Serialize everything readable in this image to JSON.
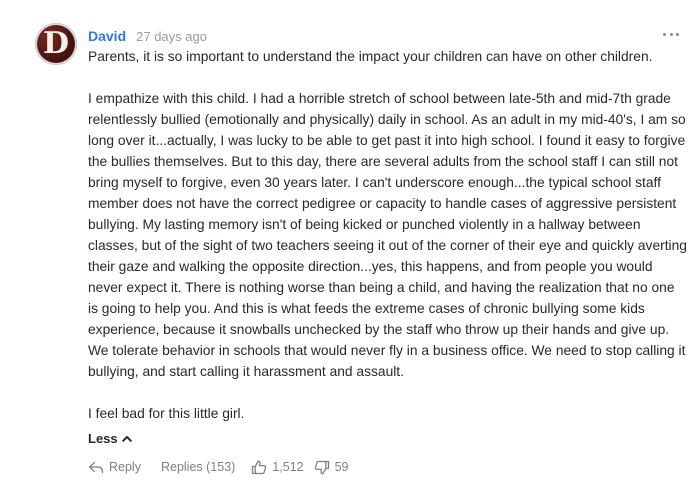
{
  "comment": {
    "avatar_letter": "D",
    "author": "David",
    "time": "27 days ago",
    "paragraphs": [
      "Parents, it is so important to understand the impact your children can have on other children.",
      "I empathize with this child. I had a horrible stretch of school between late-5th and mid-7th grade relentlessly bullied (emotionally and physically) daily in school. As an adult in my mid-40's, I am so long over it...actually, I was lucky to be able to get past it into high school. I found it easy to forgive the bullies themselves. But to this day, there are several adults from the school staff I can still not bring myself to forgive, even 30 years later. I can't underscore enough...the typical school staff member does not have the correct pedigree or capacity to handle cases of aggressive persistent bullying. My lasting memory isn't of being kicked or punched violently in a hallway between classes, but of the sight of two teachers seeing it out of the corner of their eye and quickly averting their gaze and walking the opposite direction...yes, this happens, and from people you would never expect it. There is nothing worse than being a child, and having the realization that no one is going to help you. And this is what feeds the extreme cases of chronic bullying some kids experience, because it snowballs unchecked by the staff who throw up their hands and give up. We tolerate behavior in schools that would never fly in a business office. We need to stop calling it bullying, and start calling it harassment and assault.",
      "I feel bad for this little girl."
    ],
    "less_label": "Less",
    "reply_label": "Reply",
    "replies_label": "Replies (153)",
    "upvotes": "1,512",
    "downvotes": "59"
  },
  "colors": {
    "author": "#2a7ce0",
    "text": "#232a31",
    "meta": "#979ba7",
    "actions": "#7b8089"
  },
  "icons": {
    "more": "more-horizontal-icon",
    "less": "chevron-up-icon",
    "reply": "reply-arrow-icon",
    "upvote": "thumbs-up-icon",
    "downvote": "thumbs-down-icon"
  }
}
